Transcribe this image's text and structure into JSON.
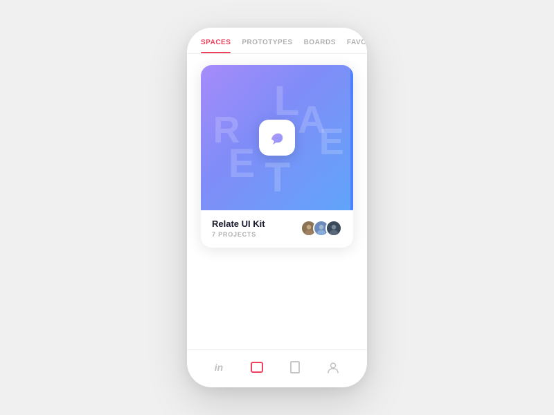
{
  "nav": {
    "tabs": [
      {
        "id": "spaces",
        "label": "SPACES",
        "active": true
      },
      {
        "id": "prototypes",
        "label": "PROTOTYPES",
        "active": false
      },
      {
        "id": "boards",
        "label": "BOARDS",
        "active": false
      },
      {
        "id": "favorites",
        "label": "FAVORITES",
        "active": false
      }
    ],
    "search_icon": "search"
  },
  "card": {
    "bg_letters": [
      "R",
      "E",
      "L",
      "A",
      "T",
      "E"
    ],
    "title": "Relate UI Kit",
    "subtitle": "7 PROJECTS",
    "avatars": [
      {
        "id": 1,
        "label": "User 1"
      },
      {
        "id": 2,
        "label": "User 2"
      },
      {
        "id": 3,
        "label": "User 3"
      }
    ]
  },
  "bottom_nav": [
    {
      "id": "in",
      "label": "in",
      "type": "text",
      "active": false
    },
    {
      "id": "boards",
      "label": "□",
      "type": "square",
      "active": true
    },
    {
      "id": "tablet",
      "label": "▭",
      "type": "tablet",
      "active": false
    },
    {
      "id": "profile",
      "label": "👤",
      "type": "person",
      "active": false
    }
  ],
  "colors": {
    "active_tab": "#f04060",
    "inactive_tab": "#b0b0b0",
    "card_gradient_start": "#a78bfa",
    "card_gradient_end": "#60a5fa",
    "blue_accent": "#2563eb",
    "boards_active": "#f04060"
  }
}
